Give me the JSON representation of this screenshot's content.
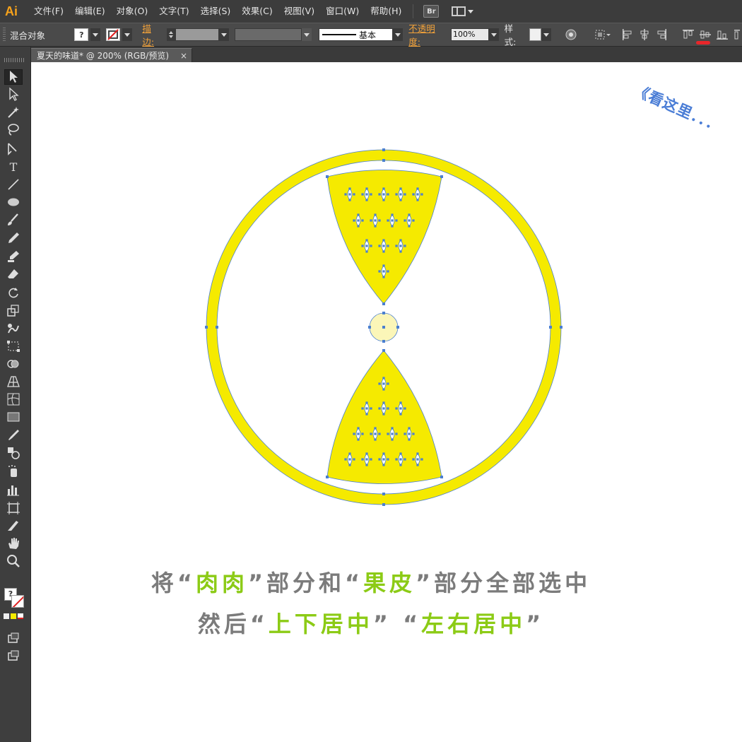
{
  "app": {
    "logo": "Ai",
    "menu": [
      "文件(F)",
      "编辑(E)",
      "对象(O)",
      "文字(T)",
      "选择(S)",
      "效果(C)",
      "视图(V)",
      "窗口(W)",
      "帮助(H)"
    ],
    "bridge_label": "Br"
  },
  "control_bar": {
    "selection_type": "混合对象",
    "fill_swatch": "?",
    "stroke_label": "描边:",
    "stroke_style": "基本",
    "opacity_label": "不透明度:",
    "opacity_value": "100%",
    "style_label": "样式:"
  },
  "document_tab": {
    "title": "夏天的味道* @ 200% (RGB/预览)",
    "close": "×"
  },
  "tools": [
    "selection-tool",
    "direct-selection-tool",
    "magic-wand-tool",
    "lasso-tool",
    "pen-tool",
    "type-tool",
    "line-tool",
    "ellipse-tool",
    "paintbrush-tool",
    "pencil-tool",
    "blob-brush-tool",
    "eraser-tool",
    "rotate-tool",
    "scale-tool",
    "warp-tool",
    "free-transform-tool",
    "shape-builder-tool",
    "perspective-grid-tool",
    "mesh-tool",
    "gradient-tool",
    "eyedropper-tool",
    "blend-tool",
    "symbol-sprayer-tool",
    "column-graph-tool",
    "artboard-tool",
    "slice-tool",
    "hand-tool",
    "zoom-tool"
  ],
  "toolbar_bottom": {
    "fill_indicator": "?"
  },
  "colors": {
    "yellow": "#f5ea00",
    "pale_yellow": "#fbf6b8",
    "anchor_blue": "#4a7fd0",
    "caption_gray": "#7b7b7b",
    "caption_green": "#8ccb16",
    "highlight_red": "#e8262a"
  },
  "annotation": {
    "hint": "《看这里．．．",
    "line1": [
      {
        "text": "将“",
        "style": "gray"
      },
      {
        "text": "肉肉",
        "style": "green"
      },
      {
        "text": "”部分和“",
        "style": "gray"
      },
      {
        "text": "果皮",
        "style": "green"
      },
      {
        "text": "”部分全部选中",
        "style": "gray"
      }
    ],
    "line2": [
      {
        "text": "然后“",
        "style": "gray"
      },
      {
        "text": "上下居中",
        "style": "green"
      },
      {
        "text": "” “",
        "style": "gray"
      },
      {
        "text": "左右居中",
        "style": "green"
      },
      {
        "text": "”",
        "style": "gray"
      }
    ]
  }
}
